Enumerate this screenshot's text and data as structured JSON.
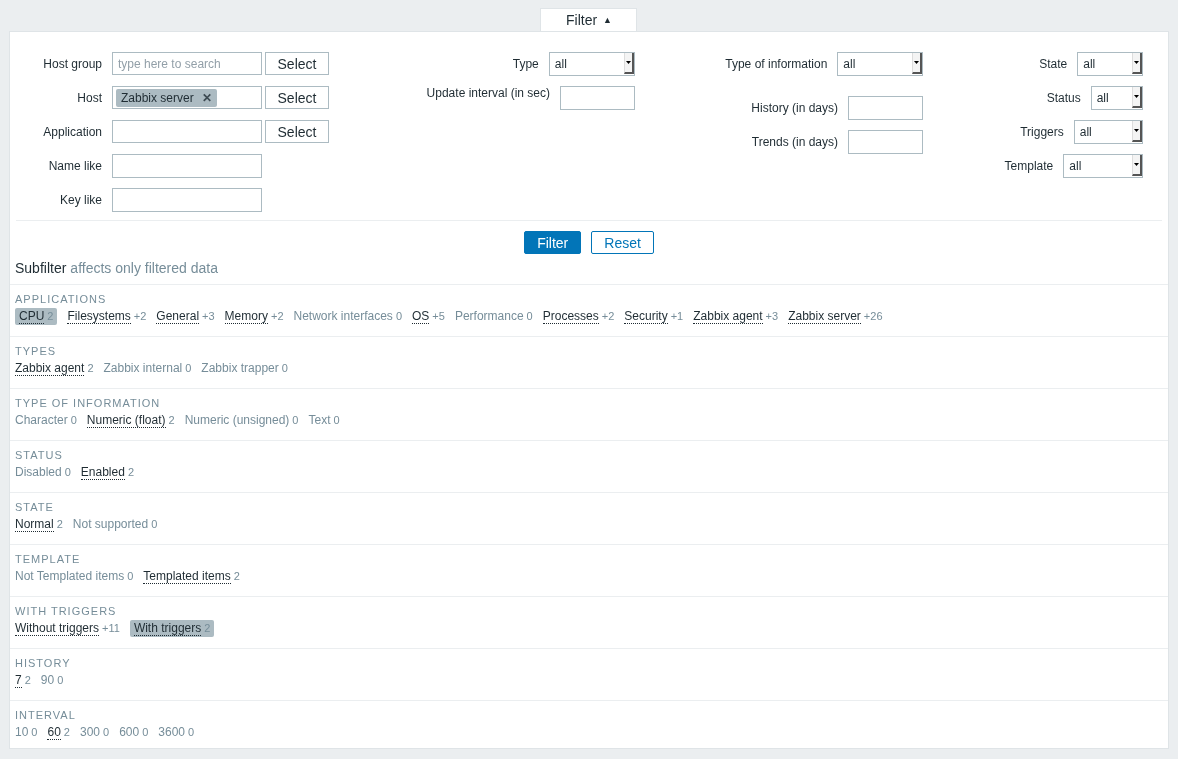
{
  "filter_tab": {
    "label": "Filter",
    "icon": "▲",
    "expanded": true
  },
  "form": {
    "columns": [
      {
        "rows": [
          {
            "label": "Host group",
            "kind": "multiselect",
            "placeholder": "type here to search",
            "tags": [],
            "button": "Select"
          },
          {
            "label": "Host",
            "kind": "multiselect",
            "tags": [
              {
                "label": "Zabbix server",
                "remove": "✕"
              }
            ],
            "button": "Select"
          },
          {
            "label": "Application",
            "kind": "multiselect",
            "tags": [],
            "button": "Select"
          },
          {
            "label": "Name like",
            "kind": "text"
          },
          {
            "label": "Key like",
            "kind": "text"
          }
        ]
      },
      {
        "rows": [
          {
            "label": "Type",
            "kind": "select",
            "value": "all"
          },
          {
            "label": "Update interval (in sec)",
            "kind": "text"
          }
        ]
      },
      {
        "rows": [
          {
            "label": "Type of information",
            "kind": "select",
            "value": "all"
          },
          {
            "label": "History (in days)",
            "kind": "text"
          },
          {
            "label": "Trends (in days)",
            "kind": "text"
          }
        ]
      },
      {
        "rows": [
          {
            "label": "State",
            "kind": "select",
            "value": "all"
          },
          {
            "label": "Status",
            "kind": "select",
            "value": "all"
          },
          {
            "label": "Triggers",
            "kind": "select",
            "value": "all"
          },
          {
            "label": "Template",
            "kind": "select",
            "value": "all"
          }
        ]
      }
    ],
    "buttons": [
      {
        "label": "Filter",
        "kind": "primary"
      },
      {
        "label": "Reset",
        "kind": "secondary"
      }
    ]
  },
  "subfilter": {
    "title": "Subfilter",
    "note": "affects only filtered data",
    "sections": [
      {
        "heading": "APPLICATIONS",
        "items": [
          {
            "label": "CPU",
            "count": "2",
            "selected": true,
            "disabled": false
          },
          {
            "label": "Filesystems",
            "count": "+2",
            "selected": false,
            "disabled": false
          },
          {
            "label": "General",
            "count": "+3",
            "selected": false,
            "disabled": false
          },
          {
            "label": "Memory",
            "count": "+2",
            "selected": false,
            "disabled": false
          },
          {
            "label": "Network interfaces",
            "count": "0",
            "selected": false,
            "disabled": true
          },
          {
            "label": "OS",
            "count": "+5",
            "selected": false,
            "disabled": false
          },
          {
            "label": "Performance",
            "count": "0",
            "selected": false,
            "disabled": true
          },
          {
            "label": "Processes",
            "count": "+2",
            "selected": false,
            "disabled": false
          },
          {
            "label": "Security",
            "count": "+1",
            "selected": false,
            "disabled": false
          },
          {
            "label": "Zabbix agent",
            "count": "+3",
            "selected": false,
            "disabled": false
          },
          {
            "label": "Zabbix server",
            "count": "+26",
            "selected": false,
            "disabled": false
          }
        ]
      },
      {
        "heading": "TYPES",
        "items": [
          {
            "label": "Zabbix agent",
            "count": "2",
            "selected": false,
            "disabled": false
          },
          {
            "label": "Zabbix internal",
            "count": "0",
            "selected": false,
            "disabled": true
          },
          {
            "label": "Zabbix trapper",
            "count": "0",
            "selected": false,
            "disabled": true
          }
        ]
      },
      {
        "heading": "TYPE OF INFORMATION",
        "items": [
          {
            "label": "Character",
            "count": "0",
            "selected": false,
            "disabled": true
          },
          {
            "label": "Numeric (float)",
            "count": "2",
            "selected": false,
            "disabled": false
          },
          {
            "label": "Numeric (unsigned)",
            "count": "0",
            "selected": false,
            "disabled": true
          },
          {
            "label": "Text",
            "count": "0",
            "selected": false,
            "disabled": true
          }
        ]
      },
      {
        "heading": "STATUS",
        "items": [
          {
            "label": "Disabled",
            "count": "0",
            "selected": false,
            "disabled": true
          },
          {
            "label": "Enabled",
            "count": "2",
            "selected": false,
            "disabled": false
          }
        ]
      },
      {
        "heading": "STATE",
        "items": [
          {
            "label": "Normal",
            "count": "2",
            "selected": false,
            "disabled": false
          },
          {
            "label": "Not supported",
            "count": "0",
            "selected": false,
            "disabled": true
          }
        ]
      },
      {
        "heading": "TEMPLATE",
        "items": [
          {
            "label": "Not Templated items",
            "count": "0",
            "selected": false,
            "disabled": true
          },
          {
            "label": "Templated items",
            "count": "2",
            "selected": false,
            "disabled": false
          }
        ]
      },
      {
        "heading": "WITH TRIGGERS",
        "items": [
          {
            "label": "Without triggers",
            "count": "+11",
            "selected": false,
            "disabled": false
          },
          {
            "label": "With triggers",
            "count": "2",
            "selected": true,
            "disabled": false
          }
        ]
      },
      {
        "heading": "HISTORY",
        "items": [
          {
            "label": "7",
            "count": "2",
            "selected": false,
            "disabled": false
          },
          {
            "label": "90",
            "count": "0",
            "selected": false,
            "disabled": true
          }
        ]
      },
      {
        "heading": "INTERVAL",
        "items": [
          {
            "label": "10",
            "count": "0",
            "selected": false,
            "disabled": true
          },
          {
            "label": "60",
            "count": "2",
            "selected": false,
            "disabled": false
          },
          {
            "label": "300",
            "count": "0",
            "selected": false,
            "disabled": true
          },
          {
            "label": "600",
            "count": "0",
            "selected": false,
            "disabled": true
          },
          {
            "label": "3600",
            "count": "0",
            "selected": false,
            "disabled": true
          }
        ]
      }
    ]
  }
}
